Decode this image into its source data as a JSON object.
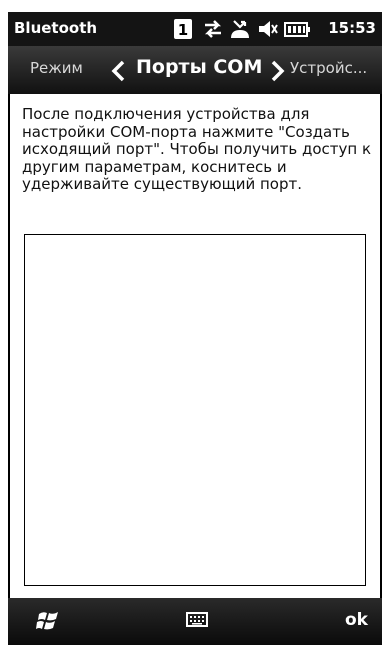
{
  "status": {
    "title": "Bluetooth",
    "sim_badge": "1",
    "time": "15:53"
  },
  "pivot": {
    "left_label": "Режим",
    "active_label": "Порты COM",
    "right_label": "Устройс..."
  },
  "main": {
    "instructions": "После подключения устройства для настройки COM-порта нажмите \"Создать исходящий порт\". Чтобы получить доступ к другим параметрам, коснитесь и удерживайте существующий порт."
  },
  "bottom": {
    "ok_label": "ok"
  },
  "icons": {
    "status": [
      "sim-1-icon",
      "data-transfer-icon",
      "missed-call-icon",
      "volume-muted-icon",
      "battery-icon"
    ],
    "bottom": [
      "windows-start-icon",
      "keyboard-icon"
    ]
  }
}
